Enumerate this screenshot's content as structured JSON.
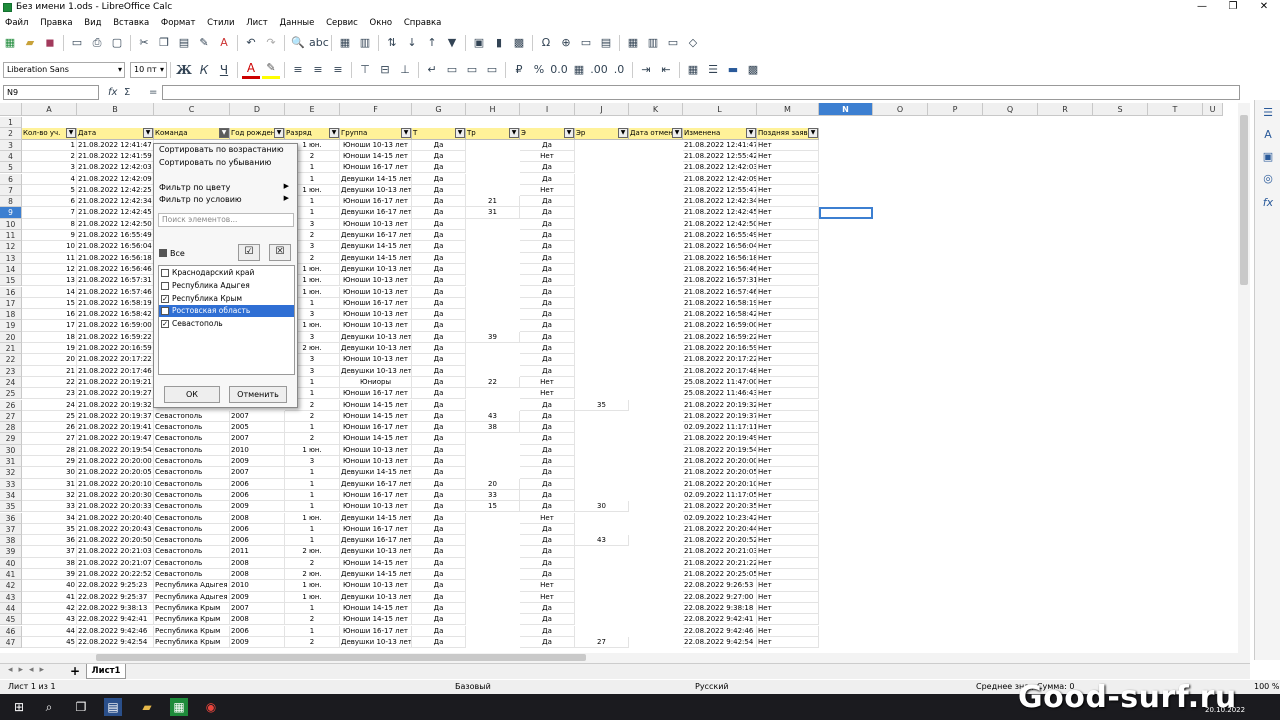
{
  "window": {
    "title": "Без имени 1.ods - LibreOffice Calc"
  },
  "menu": [
    "Файл",
    "Правка",
    "Вид",
    "Вставка",
    "Формат",
    "Стили",
    "Лист",
    "Данные",
    "Сервис",
    "Окно",
    "Справка"
  ],
  "font": {
    "name": "Liberation Sans",
    "size": "10 пт"
  },
  "namebox": "N9",
  "columns": [
    "A",
    "B",
    "C",
    "D",
    "E",
    "F",
    "G",
    "H",
    "I",
    "J",
    "K",
    "L",
    "M",
    "N",
    "O",
    "P",
    "Q",
    "R",
    "S",
    "T",
    "U"
  ],
  "headers": [
    "Кол-во уч.",
    "Дата",
    "Команда",
    "Год рожден",
    "Разряд",
    "Группа",
    "Т",
    "Тр",
    "Э",
    "Эр",
    "Дата отмен",
    "Изменена",
    "Поздняя заяв"
  ],
  "rows": [
    [
      "1",
      "21.08.2022 12:41:47",
      "",
      "",
      "1 юн.",
      "Юноши 10-13 лет",
      "Да",
      "",
      "Да",
      "",
      "",
      "21.08.2022 12:41:47",
      "Нет"
    ],
    [
      "2",
      "21.08.2022 12:41:59",
      "",
      "",
      "2",
      "Юноши 14-15 лет",
      "Да",
      "",
      "Нет",
      "",
      "",
      "21.08.2022 12:55:42",
      "Нет"
    ],
    [
      "3",
      "21.08.2022 12:42:03",
      "",
      "",
      "1",
      "Юноши 16-17 лет",
      "Да",
      "",
      "Да",
      "",
      "",
      "21.08.2022 12:42:03",
      "Нет"
    ],
    [
      "4",
      "21.08.2022 12:42:09",
      "",
      "",
      "1",
      "Девушки 14-15 лет",
      "Да",
      "",
      "Да",
      "",
      "",
      "21.08.2022 12:42:09",
      "Нет"
    ],
    [
      "5",
      "21.08.2022 12:42:25",
      "",
      "",
      "1 юн.",
      "Девушки 10-13 лет",
      "Да",
      "",
      "Нет",
      "",
      "",
      "21.08.2022 12:55:47",
      "Нет"
    ],
    [
      "6",
      "21.08.2022 12:42:34",
      "",
      "",
      "1",
      "Юноши 16-17 лет",
      "Да",
      "21",
      "Да",
      "",
      "",
      "21.08.2022 12:42:34",
      "Нет"
    ],
    [
      "7",
      "21.08.2022 12:42:45",
      "",
      "",
      "1",
      "Девушки 16-17 лет",
      "Да",
      "31",
      "Да",
      "",
      "",
      "21.08.2022 12:42:45",
      "Нет"
    ],
    [
      "8",
      "21.08.2022 12:42:50",
      "",
      "",
      "3",
      "Юноши 10-13 лет",
      "Да",
      "",
      "Да",
      "",
      "",
      "21.08.2022 12:42:50",
      "Нет"
    ],
    [
      "9",
      "21.08.2022 16:55:49",
      "",
      "",
      "2",
      "Девушки 16-17 лет",
      "Да",
      "",
      "Да",
      "",
      "",
      "21.08.2022 16:55:49",
      "Нет"
    ],
    [
      "10",
      "21.08.2022 16:56:04",
      "",
      "",
      "3",
      "Девушки 14-15 лет",
      "Да",
      "",
      "Да",
      "",
      "",
      "21.08.2022 16:56:04",
      "Нет"
    ],
    [
      "11",
      "21.08.2022 16:56:18",
      "",
      "",
      "2",
      "Девушки 14-15 лет",
      "Да",
      "",
      "Да",
      "",
      "",
      "21.08.2022 16:56:18",
      "Нет"
    ],
    [
      "12",
      "21.08.2022 16:56:46",
      "",
      "",
      "1 юн.",
      "Девушки 10-13 лет",
      "Да",
      "",
      "Да",
      "",
      "",
      "21.08.2022 16:56:46",
      "Нет"
    ],
    [
      "13",
      "21.08.2022 16:57:31",
      "",
      "",
      "1 юн.",
      "Юноши 10-13 лет",
      "Да",
      "",
      "Да",
      "",
      "",
      "21.08.2022 16:57:31",
      "Нет"
    ],
    [
      "14",
      "21.08.2022 16:57:46",
      "",
      "",
      "1 юн.",
      "Юноши 10-13 лет",
      "Да",
      "",
      "Да",
      "",
      "",
      "21.08.2022 16:57:46",
      "Нет"
    ],
    [
      "15",
      "21.08.2022 16:58:19",
      "",
      "",
      "1",
      "Юноши 16-17 лет",
      "Да",
      "",
      "Да",
      "",
      "",
      "21.08.2022 16:58:19",
      "Нет"
    ],
    [
      "16",
      "21.08.2022 16:58:42",
      "",
      "",
      "3",
      "Юноши 10-13 лет",
      "Да",
      "",
      "Да",
      "",
      "",
      "21.08.2022 16:58:42",
      "Нет"
    ],
    [
      "17",
      "21.08.2022 16:59:00",
      "",
      "",
      "1 юн.",
      "Юноши 10-13 лет",
      "Да",
      "",
      "Да",
      "",
      "",
      "21.08.2022 16:59:00",
      "Нет"
    ],
    [
      "18",
      "21.08.2022 16:59:22",
      "",
      "",
      "3",
      "Девушки 10-13 лет",
      "Да",
      "39",
      "Да",
      "",
      "",
      "21.08.2022 16:59:22",
      "Нет"
    ],
    [
      "19",
      "21.08.2022 20:16:59",
      "",
      "",
      "2 юн.",
      "Девушки 10-13 лет",
      "Да",
      "",
      "Да",
      "",
      "",
      "21.08.2022 20:16:59",
      "Нет"
    ],
    [
      "20",
      "21.08.2022 20:17:22",
      "",
      "",
      "3",
      "Юноши 10-13 лет",
      "Да",
      "",
      "Да",
      "",
      "",
      "21.08.2022 20:17:22",
      "Нет"
    ],
    [
      "21",
      "21.08.2022 20:17:46",
      "",
      "",
      "3",
      "Девушки 10-13 лет",
      "Да",
      "",
      "Да",
      "",
      "",
      "21.08.2022 20:17:48",
      "Нет"
    ],
    [
      "22",
      "21.08.2022 20:19:21",
      "",
      "",
      "1",
      "Юниоры",
      "Да",
      "22",
      "Нет",
      "",
      "",
      "25.08.2022 11:47:00",
      "Нет"
    ],
    [
      "23",
      "21.08.2022 20:19:27",
      "",
      "",
      "1",
      "Юноши 16-17 лет",
      "Да",
      "",
      "Нет",
      "",
      "",
      "25.08.2022 11:46:43",
      "Нет"
    ],
    [
      "24",
      "21.08.2022 20:19:32",
      "",
      "",
      "2",
      "Юноши 14-15 лет",
      "Да",
      "",
      "Да",
      "35",
      "",
      "21.08.2022 20:19:32",
      "Нет"
    ],
    [
      "25",
      "21.08.2022 20:19:37",
      "Севастополь",
      "2007",
      "2",
      "Юноши 14-15 лет",
      "Да",
      "43",
      "Да",
      "",
      "",
      "21.08.2022 20:19:37",
      "Нет"
    ],
    [
      "26",
      "21.08.2022 20:19:41",
      "Севастополь",
      "2005",
      "1",
      "Юноши 16-17 лет",
      "Да",
      "38",
      "Да",
      "",
      "",
      "02.09.2022 11:17:11",
      "Нет"
    ],
    [
      "27",
      "21.08.2022 20:19:47",
      "Севастополь",
      "2007",
      "2",
      "Юноши 14-15 лет",
      "Да",
      "",
      "Да",
      "",
      "",
      "21.08.2022 20:19:49",
      "Нет"
    ],
    [
      "28",
      "21.08.2022 20:19:54",
      "Севастополь",
      "2010",
      "1 юн.",
      "Юноши 10-13 лет",
      "Да",
      "",
      "Да",
      "",
      "",
      "21.08.2022 20:19:54",
      "Нет"
    ],
    [
      "29",
      "21.08.2022 20:20:00",
      "Севастополь",
      "2009",
      "3",
      "Юноши 10-13 лет",
      "Да",
      "",
      "Да",
      "",
      "",
      "21.08.2022 20:20:00",
      "Нет"
    ],
    [
      "30",
      "21.08.2022 20:20:05",
      "Севастополь",
      "2007",
      "1",
      "Девушки 14-15 лет",
      "Да",
      "",
      "Да",
      "",
      "",
      "21.08.2022 20:20:05",
      "Нет"
    ],
    [
      "31",
      "21.08.2022 20:20:10",
      "Севастополь",
      "2006",
      "1",
      "Девушки 16-17 лет",
      "Да",
      "20",
      "Да",
      "",
      "",
      "21.08.2022 20:20:10",
      "Нет"
    ],
    [
      "32",
      "21.08.2022 20:20:30",
      "Севастополь",
      "2006",
      "1",
      "Юноши 16-17 лет",
      "Да",
      "33",
      "Да",
      "",
      "",
      "02.09.2022 11:17:05",
      "Нет"
    ],
    [
      "33",
      "21.08.2022 20:20:33",
      "Севастополь",
      "2009",
      "1",
      "Юноши 10-13 лет",
      "Да",
      "15",
      "Да",
      "30",
      "",
      "21.08.2022 20:20:35",
      "Нет"
    ],
    [
      "34",
      "21.08.2022 20:20:40",
      "Севастополь",
      "2008",
      "1 юн.",
      "Девушки 14-15 лет",
      "Да",
      "",
      "Нет",
      "",
      "",
      "02.09.2022 10:23:42",
      "Нет"
    ],
    [
      "35",
      "21.08.2022 20:20:43",
      "Севастополь",
      "2006",
      "1",
      "Юноши 16-17 лет",
      "Да",
      "",
      "Да",
      "",
      "",
      "21.08.2022 20:20:44",
      "Нет"
    ],
    [
      "36",
      "21.08.2022 20:20:50",
      "Севастополь",
      "2006",
      "1",
      "Девушки 16-17 лет",
      "Да",
      "",
      "Да",
      "43",
      "",
      "21.08.2022 20:20:52",
      "Нет"
    ],
    [
      "37",
      "21.08.2022 20:21:03",
      "Севастополь",
      "2011",
      "2 юн.",
      "Девушки 10-13 лет",
      "Да",
      "",
      "Да",
      "",
      "",
      "21.08.2022 20:21:03",
      "Нет"
    ],
    [
      "38",
      "21.08.2022 20:21:07",
      "Севастополь",
      "2008",
      "2",
      "Юноши 14-15 лет",
      "Да",
      "",
      "Да",
      "",
      "",
      "21.08.2022 20:21:22",
      "Нет"
    ],
    [
      "39",
      "21.08.2022 20:22:52",
      "Севастополь",
      "2008",
      "2 юн.",
      "Девушки 14-15 лет",
      "Да",
      "",
      "Да",
      "",
      "",
      "21.08.2022 20:25:05",
      "Нет"
    ],
    [
      "40",
      "22.08.2022 9:25:23",
      "Республика Адыгея",
      "2010",
      "1 юн.",
      "Юноши 10-13 лет",
      "Да",
      "",
      "Нет",
      "",
      "",
      "22.08.2022 9:26:53",
      "Нет"
    ],
    [
      "41",
      "22.08.2022 9:25:37",
      "Республика Адыгея",
      "2009",
      "1 юн.",
      "Девушки 10-13 лет",
      "Да",
      "",
      "Нет",
      "",
      "",
      "22.08.2022 9:27:00",
      "Нет"
    ],
    [
      "42",
      "22.08.2022 9:38:13",
      "Республика Крым",
      "2007",
      "1",
      "Юноши 14-15 лет",
      "Да",
      "",
      "Да",
      "",
      "",
      "22.08.2022 9:38:18",
      "Нет"
    ],
    [
      "43",
      "22.08.2022 9:42:41",
      "Республика Крым",
      "2008",
      "2",
      "Юноши 14-15 лет",
      "Да",
      "",
      "Да",
      "",
      "",
      "22.08.2022 9:42:41",
      "Нет"
    ],
    [
      "44",
      "22.08.2022 9:42:46",
      "Республика Крым",
      "2006",
      "1",
      "Юноши 16-17 лет",
      "Да",
      "",
      "Да",
      "",
      "",
      "22.08.2022 9:42:46",
      "Нет"
    ],
    [
      "45",
      "22.08.2022 9:42:54",
      "Республика Крым",
      "2009",
      "2",
      "Девушки 10-13 лет",
      "Да",
      "",
      "Да",
      "27",
      "",
      "22.08.2022 9:42:54",
      "Нет"
    ]
  ],
  "popup": {
    "sort_asc": "Сортировать по возрастанию",
    "sort_desc": "Сортировать по убыванию",
    "filter_color": "Фильтр по цвету",
    "filter_cond": "Фильтр по условию",
    "search_placeholder": "Поиск элементов...",
    "all": "Все",
    "items": [
      {
        "label": "Краснодарский край",
        "checked": false
      },
      {
        "label": "Республика Адыгея",
        "checked": false
      },
      {
        "label": "Республика Крым",
        "checked": true
      },
      {
        "label": "Ростовская область",
        "checked": false
      },
      {
        "label": "Севастополь",
        "checked": true
      }
    ],
    "ok": "ОК",
    "cancel": "Отменить"
  },
  "sheet_tab": "Лист1",
  "status": {
    "sheet": "Лист 1 из 1",
    "style": "Базовый",
    "lang": "Русский",
    "sum": "Среднее зна        ; Сумма: 0",
    "zoom": "100 %"
  },
  "watermark": "Good-surf.ru",
  "clock": "20.10.2022"
}
